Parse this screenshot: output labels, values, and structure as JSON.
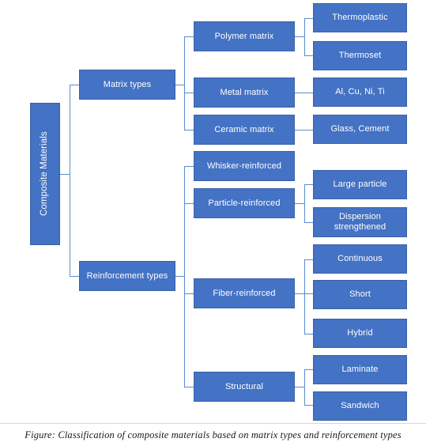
{
  "diagram": {
    "title": "Classification of composite materials",
    "colors": {
      "node_fill": "#4472C4",
      "node_border": "#3A61A8",
      "node_text": "#FFFFFF",
      "connector": "#5B8BD0",
      "background": "#FFFFFF",
      "caption_text": "#1A1A1A"
    },
    "root": {
      "label": "Composite Materials"
    },
    "level1": [
      {
        "id": "matrix-types",
        "label": "Matrix types"
      },
      {
        "id": "reinforcement-types",
        "label": "Reinforcement types"
      }
    ],
    "level2": [
      {
        "id": "polymer-matrix",
        "label": "Polymer matrix",
        "parent": "matrix-types"
      },
      {
        "id": "metal-matrix",
        "label": "Metal matrix",
        "parent": "matrix-types"
      },
      {
        "id": "ceramic-matrix",
        "label": "Ceramic matrix",
        "parent": "matrix-types"
      },
      {
        "id": "whisker-reinforced",
        "label": "Whisker-reinforced",
        "parent": "reinforcement-types"
      },
      {
        "id": "particle-reinforced",
        "label": "Particle-reinforced",
        "parent": "reinforcement-types"
      },
      {
        "id": "fiber-reinforced",
        "label": "Fiber-reinforced",
        "parent": "reinforcement-types"
      },
      {
        "id": "structural",
        "label": "Structural",
        "parent": "reinforcement-types"
      }
    ],
    "level3": [
      {
        "id": "thermoplastic",
        "label": "Thermoplastic",
        "parent": "polymer-matrix"
      },
      {
        "id": "thermoset",
        "label": "Thermoset",
        "parent": "polymer-matrix"
      },
      {
        "id": "metals-list",
        "label": "Al, Cu, Ni, Ti",
        "parent": "metal-matrix"
      },
      {
        "id": "ceramics-list",
        "label": "Glass, Cement",
        "parent": "ceramic-matrix"
      },
      {
        "id": "large-particle",
        "label": "Large particle",
        "parent": "particle-reinforced"
      },
      {
        "id": "dispersion-strengthened",
        "label": "Dispersion strengthened",
        "parent": "particle-reinforced"
      },
      {
        "id": "continuous",
        "label": "Continuous",
        "parent": "fiber-reinforced"
      },
      {
        "id": "short",
        "label": "Short",
        "parent": "fiber-reinforced"
      },
      {
        "id": "hybrid",
        "label": "Hybrid",
        "parent": "fiber-reinforced"
      },
      {
        "id": "laminate",
        "label": "Laminate",
        "parent": "structural"
      },
      {
        "id": "sandwich",
        "label": "Sandwich",
        "parent": "structural"
      }
    ]
  },
  "caption": {
    "text": "Figure: Classification of composite materials based on matrix types and reinforcement types"
  }
}
